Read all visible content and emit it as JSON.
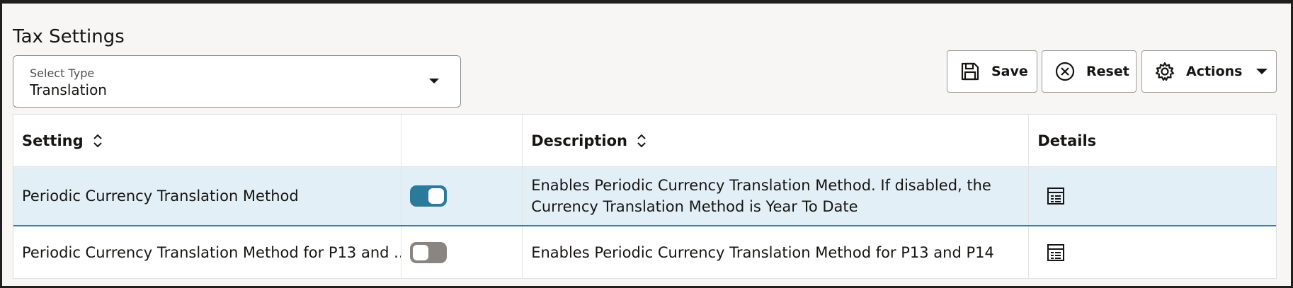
{
  "page": {
    "title": "Tax Settings"
  },
  "select": {
    "label": "Select Type",
    "value": "Translation"
  },
  "toolbar": {
    "save_label": "Save",
    "reset_label": "Reset",
    "actions_label": "Actions"
  },
  "table": {
    "columns": {
      "setting": "Setting",
      "toggle": "",
      "description": "Description",
      "details": "Details"
    },
    "rows": [
      {
        "setting": "Periodic Currency Translation Method",
        "enabled": true,
        "description": "Enables Periodic Currency Translation Method. If disabled, the Currency Translation Method is Year To Date"
      },
      {
        "setting": "Periodic Currency Translation Method for P13 and ...",
        "enabled": false,
        "description": "Enables Periodic Currency Translation Method for P13 and P14"
      }
    ]
  },
  "colors": {
    "accent": "#2b7a9c",
    "selected_row": "#e3eff6",
    "toggle_off": "#8a8580"
  },
  "icons": {
    "save": "save-icon",
    "reset": "reset-icon",
    "actions": "gear-icon",
    "sort": "sort-icon",
    "details": "details-icon"
  }
}
